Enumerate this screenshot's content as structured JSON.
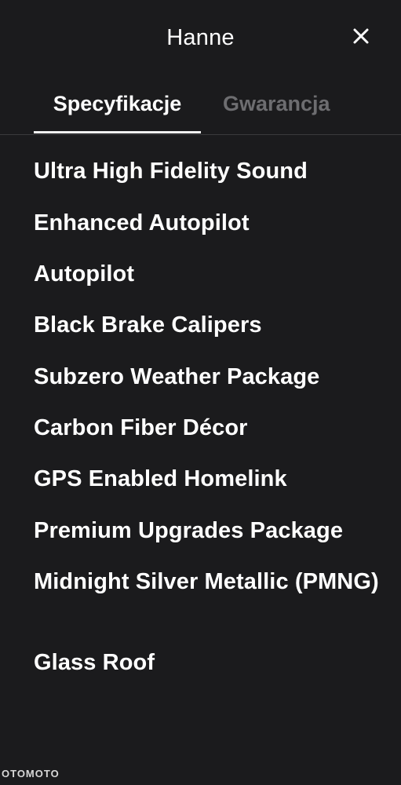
{
  "header": {
    "title": "Hanne",
    "close_icon": "close-icon"
  },
  "tabs": [
    {
      "label": "Specyfikacje",
      "active": true
    },
    {
      "label": "Gwarancja",
      "active": false
    }
  ],
  "features": [
    "Ultra High Fidelity Sound",
    "Enhanced Autopilot",
    "Autopilot",
    "Black Brake Calipers",
    "Subzero Weather Package",
    "Carbon Fiber Décor",
    "GPS Enabled Homelink",
    "Premium Upgrades Package",
    "Midnight Silver Metallic (PMNG)",
    "Glass Roof"
  ],
  "watermark": "OTOMOTO",
  "colors": {
    "background": "#1b1b1d",
    "text_primary": "#ffffff",
    "text_muted": "#6d6d70",
    "divider": "#3a3a3d"
  }
}
